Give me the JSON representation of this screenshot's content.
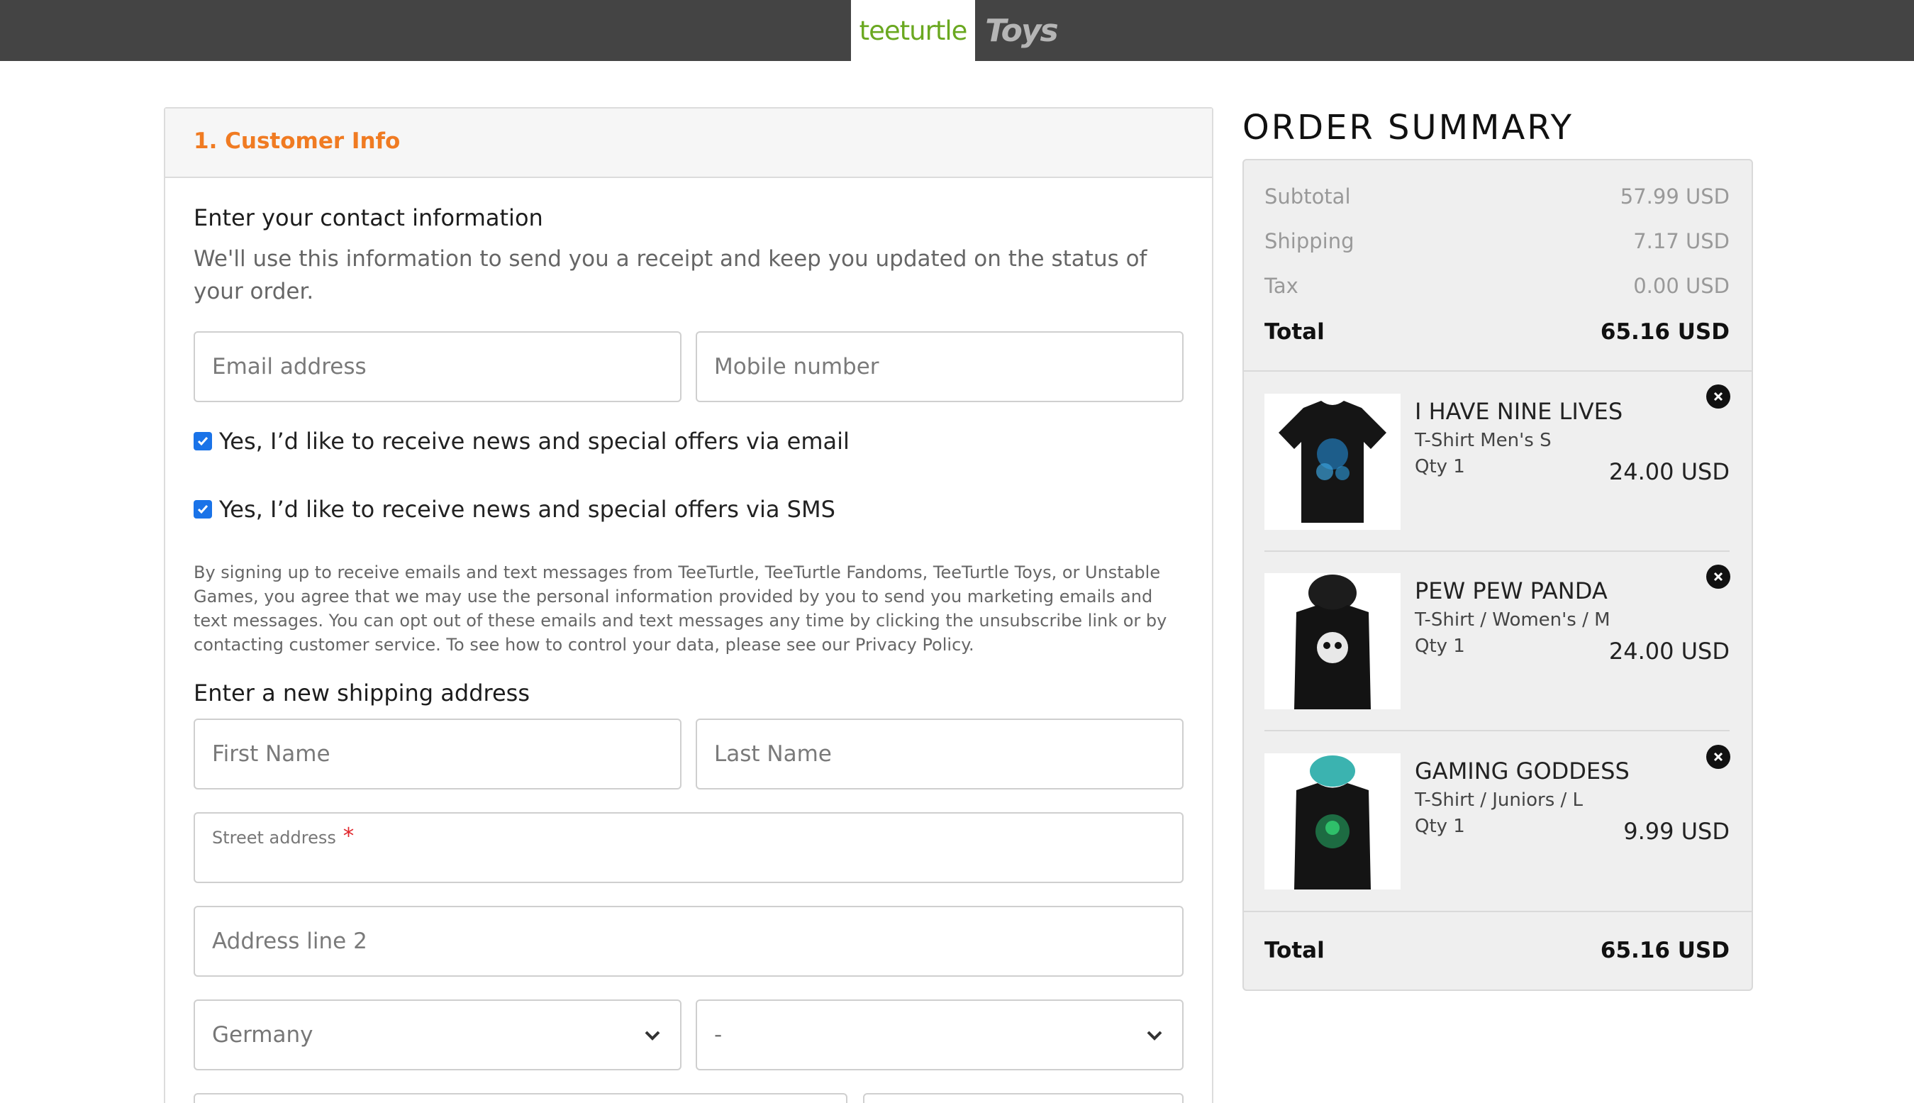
{
  "header": {
    "brand_primary": "teeturtle",
    "brand_secondary": "Toys"
  },
  "customer_info": {
    "step_title": "1. Customer Info",
    "contact_heading": "Enter your contact information",
    "contact_description": "We'll use this information to send you a receipt and keep you updated on the status of your order.",
    "email_placeholder": "Email address",
    "mobile_placeholder": "Mobile number",
    "email_optin_label": "Yes, I’d like to receive news and special offers via email",
    "email_optin_checked": true,
    "sms_optin_label": "Yes, I’d like to receive news and special offers via SMS",
    "sms_optin_checked": true,
    "legal_text": "By signing up to receive emails and text messages from TeeTurtle, TeeTurtle Fandoms, TeeTurtle Toys, or Unstable Games, you agree that we may use the personal information provided by you to send you marketing emails and text messages. You can opt out of these emails and text messages any time by clicking the unsubscribe link or by contacting customer service. To see how to control your data, please see our Privacy Policy."
  },
  "shipping": {
    "heading": "Enter a new shipping address",
    "first_name_placeholder": "First Name",
    "last_name_placeholder": "Last Name",
    "street_label": "Street address",
    "street_required_mark": "*",
    "address2_placeholder": "Address line 2",
    "country_value": "Germany",
    "region_value": "-"
  },
  "order_summary": {
    "title": "ORDER SUMMARY",
    "subtotal_label": "Subtotal",
    "subtotal_value": "57.99 USD",
    "shipping_label": "Shipping",
    "shipping_value": "7.17 USD",
    "tax_label": "Tax",
    "tax_value": "0.00 USD",
    "total_label": "Total",
    "total_value": "65.16 USD",
    "items": [
      {
        "name": "I HAVE NINE LIVES",
        "variant": "T-Shirt Men's S",
        "qty": "Qty 1",
        "price": "24.00 USD",
        "icon": "tshirt-thumbnail"
      },
      {
        "name": "PEW PEW PANDA",
        "variant": "T-Shirt / Women's / M",
        "qty": "Qty 1",
        "price": "24.00 USD",
        "icon": "tshirt-thumbnail"
      },
      {
        "name": "GAMING GODDESS",
        "variant": "T-Shirt / Juniors / L",
        "qty": "Qty 1",
        "price": "9.99 USD",
        "icon": "tshirt-thumbnail"
      }
    ],
    "footer_total_label": "Total",
    "footer_total_value": "65.16 USD"
  },
  "colors": {
    "topbar": "#444444",
    "brand_green": "#6aa820",
    "accent_orange": "#f07b22",
    "checkbox_blue": "#1a73e8",
    "required_red": "#e0262c"
  }
}
